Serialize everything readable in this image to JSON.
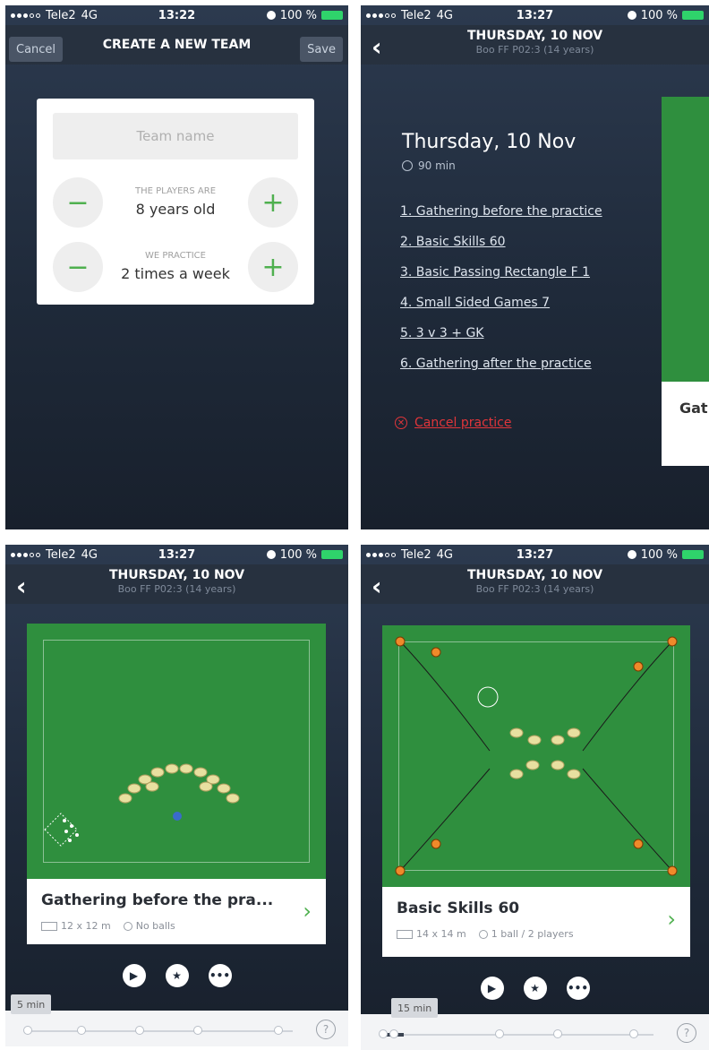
{
  "statusbar": {
    "carrier": "Tele2",
    "network": "4G",
    "battery": "100 %"
  },
  "screen1": {
    "time": "13:22",
    "cancel": "Cancel",
    "title": "CREATE A NEW TEAM",
    "save": "Save",
    "team_name_placeholder": "Team name",
    "players_label": "THE PLAYERS ARE",
    "players_value": "8 years old",
    "practice_label": "WE PRACTICE",
    "practice_value": "2 times a week",
    "minus": "−",
    "plus": "+"
  },
  "practice_header": {
    "time": "13:27",
    "title": "THURSDAY, 10 NOV",
    "subtitle": "Boo FF P02:3 (14 years)"
  },
  "screen2": {
    "title": "Thursday, 10 Nov",
    "duration": "90 min",
    "exercises": [
      "1. Gathering before the practice",
      "2. Basic Skills 60",
      "3. Basic Passing Rectangle F 1",
      "4. Small Sided Games 7",
      "5. 3 v 3 + GK",
      "6. Gathering after the practice"
    ],
    "cancel": "Cancel practice",
    "peek_title": "Gat"
  },
  "screen3": {
    "title": "Gathering before the pra...",
    "size": "12 x 12 m",
    "balls": "No balls",
    "timeline_badge": "5 min",
    "progress": 0.0
  },
  "screen4": {
    "title": "Basic Skills 60",
    "size": "14 x 14 m",
    "balls": "1 ball / 2 players",
    "timeline_badge": "15 min",
    "progress": 0.08
  },
  "actions": {
    "play": "▶",
    "star": "★",
    "more": "•••"
  },
  "help": "?"
}
